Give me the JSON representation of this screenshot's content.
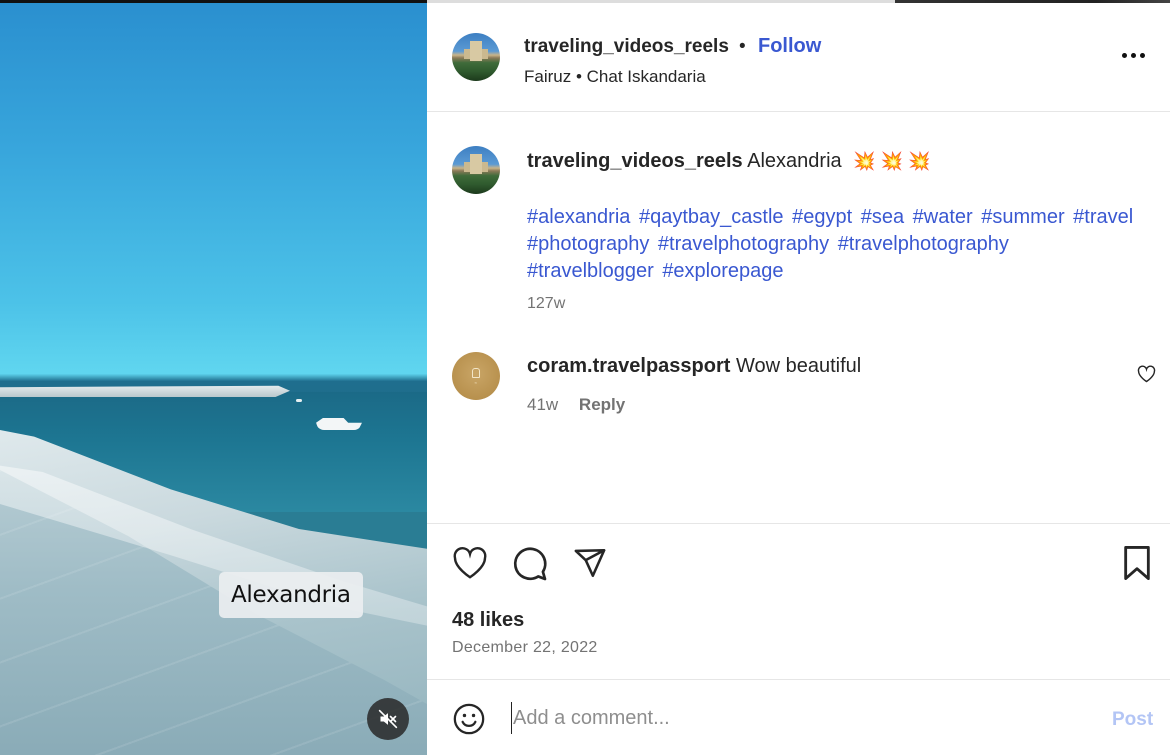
{
  "video": {
    "overlay_text": "Alexandria",
    "mute_icon": "speaker-muted-icon"
  },
  "header": {
    "username": "traveling_videos_reels",
    "separator": "•",
    "follow_label": "Follow",
    "subtitle": "Fairuz • Chat Iskandaria",
    "more_icon": "more-options-icon"
  },
  "caption": {
    "username": "traveling_videos_reels",
    "text": "Alexandria",
    "emojis": "💥 💥 💥",
    "hashtags": [
      "#alexandria",
      "#qaytbay_castle",
      "#egypt",
      "#sea",
      "#water",
      "#summer",
      "#travel",
      "#photography",
      "#travelphotography",
      "#travelphotography",
      "#travelblogger",
      "#explorepage"
    ],
    "time": "127w"
  },
  "comments": [
    {
      "username": "coram.travelpassport",
      "text": "Wow beautiful",
      "time": "41w",
      "reply_label": "Reply"
    }
  ],
  "actions": {
    "icons": [
      "heart-icon",
      "comment-icon",
      "share-icon",
      "bookmark-icon"
    ],
    "likes": "48 likes",
    "date": "December 22, 2022"
  },
  "comment_box": {
    "placeholder": "Add a comment...",
    "post_label": "Post"
  },
  "colors": {
    "accent": "#3a58d1",
    "post_disabled": "#b3c5f5",
    "muted_text": "#737373"
  }
}
